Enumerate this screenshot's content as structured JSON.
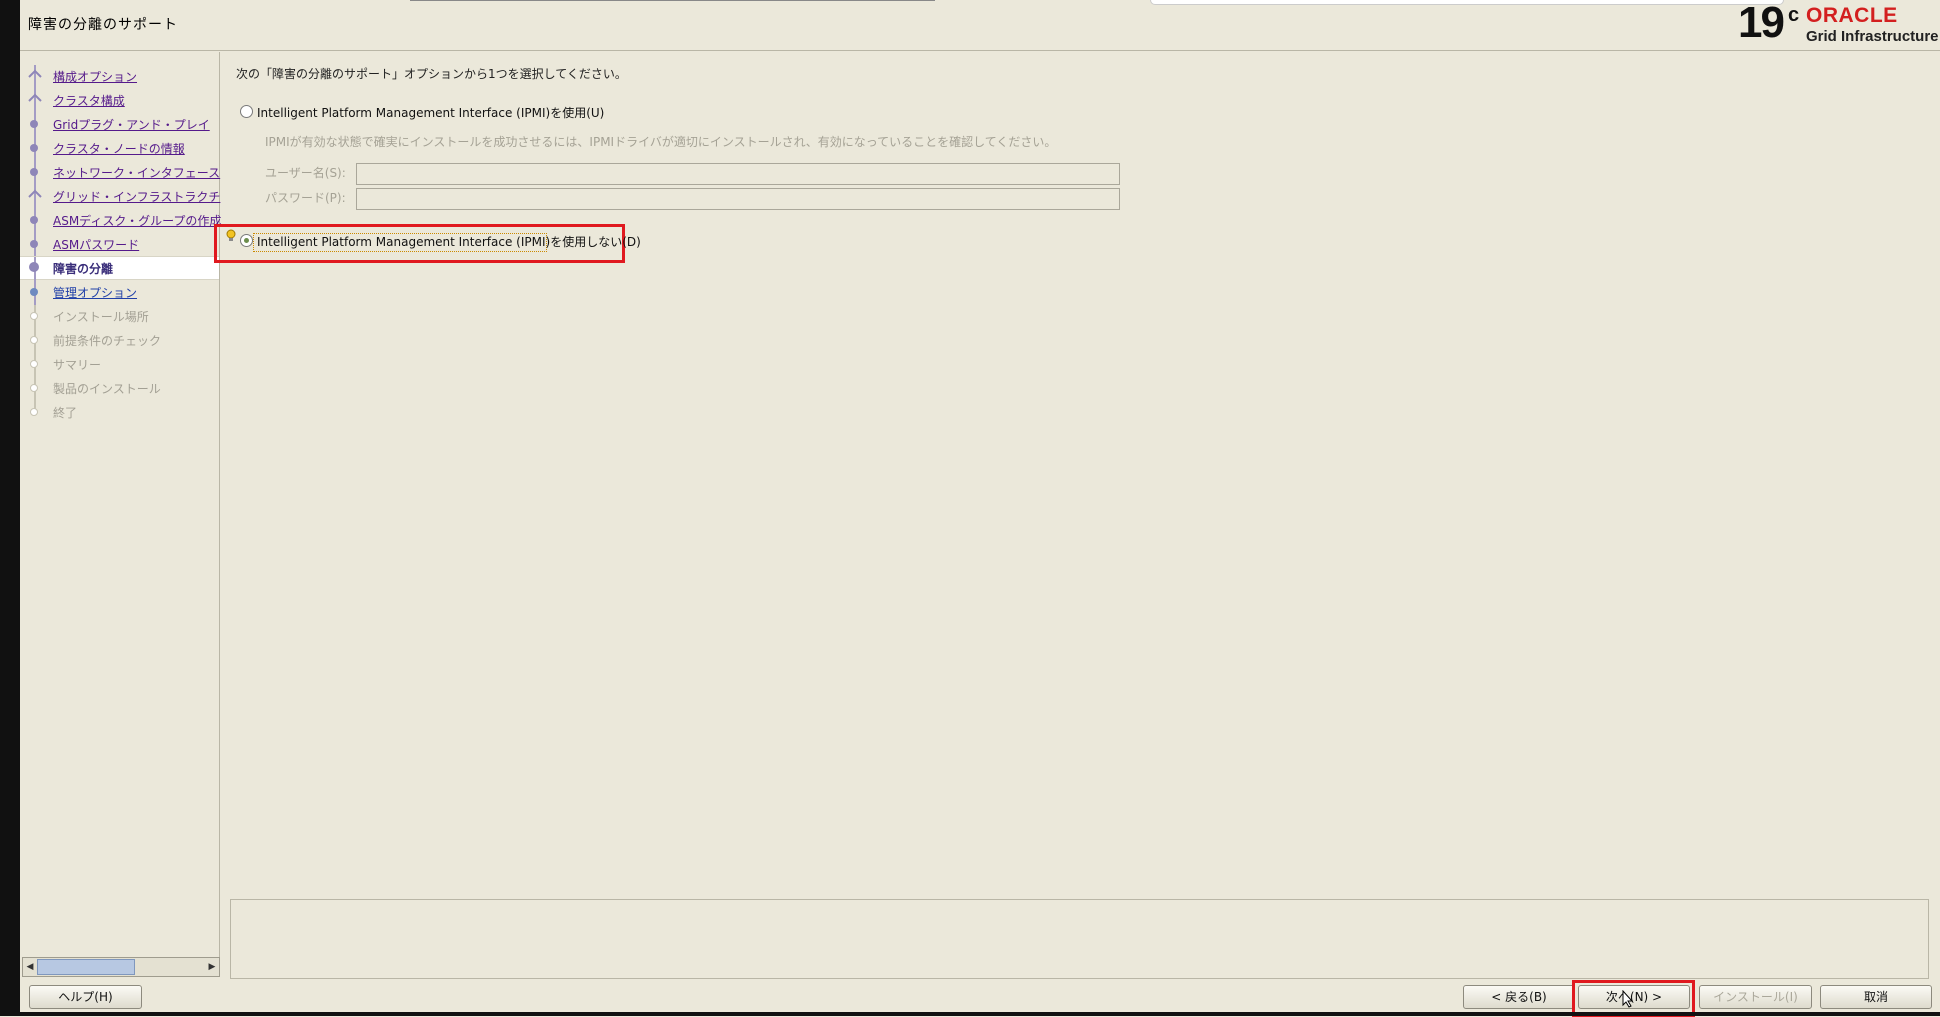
{
  "page": {
    "title": "障害の分離のサポート"
  },
  "logo": {
    "version": "19",
    "version_sup": "c",
    "brand": "ORACLE",
    "product": "Grid Infrastructure"
  },
  "sidebar": {
    "steps": [
      {
        "label": "構成オプション",
        "state": "done"
      },
      {
        "label": "クラスタ構成",
        "state": "done"
      },
      {
        "label": "Gridプラグ・アンド・プレイ",
        "state": "done"
      },
      {
        "label": "クラスタ・ノードの情報",
        "state": "done"
      },
      {
        "label": "ネットワーク・インタフェース",
        "state": "done"
      },
      {
        "label": "グリッド・インフラストラクチ",
        "state": "done"
      },
      {
        "label": "ASMディスク・グループの作成",
        "state": "done"
      },
      {
        "label": "ASMパスワード",
        "state": "done"
      },
      {
        "label": "障害の分離",
        "state": "active"
      },
      {
        "label": "管理オプション",
        "state": "link"
      },
      {
        "label": "インストール場所",
        "state": "pending"
      },
      {
        "label": "前提条件のチェック",
        "state": "pending"
      },
      {
        "label": "サマリー",
        "state": "pending"
      },
      {
        "label": "製品のインストール",
        "state": "pending"
      },
      {
        "label": "終了",
        "state": "pending"
      }
    ]
  },
  "main": {
    "instruction": "次の「障害の分離のサポート」オプションから1つを選択してください。",
    "option_use": "Intelligent Platform Management Interface (IPMI)を使用(U)",
    "note": "IPMIが有効な状態で確実にインストールを成功させるには、IPMIドライバが適切にインストールされ、有効になっていることを確認してください。",
    "username_label": "ユーザー名(S):",
    "username_value": "",
    "password_label": "パスワード(P):",
    "password_value": "",
    "option_do_not_use": "Intelligent Platform Management Interface (IPMI)を使用しない(D)",
    "selected_option": "option_do_not_use"
  },
  "buttons": {
    "help": "ヘルプ(H)",
    "back": "< 戻る(B)",
    "next": "次へ(N) >",
    "install": "インストール(I)",
    "cancel": "取消"
  },
  "colors": {
    "background": "#ebe8da",
    "highlight": "#e0191f",
    "brand_red": "#d31f1f",
    "visited_link": "#551a8b"
  }
}
